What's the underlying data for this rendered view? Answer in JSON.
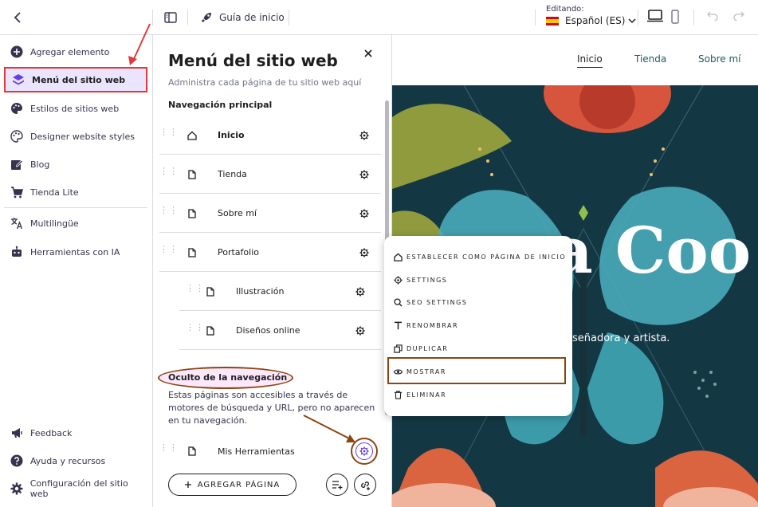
{
  "topbar": {
    "guide_label": "Guía de inicio",
    "editing_label": "Editando:",
    "language": "Español (ES)"
  },
  "sidebar": {
    "items": [
      {
        "label": "Agregar elemento",
        "icon": "plus-circle-icon"
      },
      {
        "label": "Menú del sitio web",
        "icon": "layers-icon",
        "active": true
      },
      {
        "label": "Estilos de sitios web",
        "icon": "palette-icon"
      },
      {
        "label": "Designer website styles",
        "icon": "palette-icon"
      },
      {
        "label": "Blog",
        "icon": "edit-icon"
      },
      {
        "label": "Tienda Lite",
        "icon": "cart-icon"
      },
      {
        "label": "Multilingüe",
        "icon": "translate-icon"
      },
      {
        "label": "Herramientas con IA",
        "icon": "robot-icon"
      }
    ],
    "bottom": [
      {
        "label": "Feedback",
        "icon": "megaphone-icon"
      },
      {
        "label": "Ayuda y recursos",
        "icon": "help-icon"
      },
      {
        "label": "Configuración del sitio web",
        "icon": "gear-icon"
      }
    ]
  },
  "panel": {
    "title": "Menú del sitio web",
    "subtitle": "Administra cada página de tu sitio web aquí",
    "main_nav_heading": "Navegación principal",
    "pages": [
      {
        "label": "Inicio",
        "icon": "home-icon",
        "bold": true,
        "indent": 0
      },
      {
        "label": "Tienda",
        "icon": "page-icon",
        "indent": 0
      },
      {
        "label": "Sobre mí",
        "icon": "page-icon",
        "indent": 0
      },
      {
        "label": "Portafolio",
        "icon": "page-icon",
        "indent": 0
      },
      {
        "label": "Illustración",
        "icon": "page-icon",
        "indent": 1
      },
      {
        "label": "Diseños online",
        "icon": "page-icon",
        "indent": 1
      }
    ],
    "hidden_heading": "Oculto de la navegación",
    "hidden_description": "Estas páginas son accesibles a través de motores de búsqueda y URL, pero no aparecen en tu navegación.",
    "hidden_pages": [
      {
        "label": "Mis Herramientas",
        "icon": "page-icon"
      }
    ],
    "add_page_label": "AGREGAR PÁGINA"
  },
  "preview": {
    "nav": [
      "Inicio",
      "Tienda",
      "Sobre mí"
    ],
    "hero_title": "a Coo",
    "hero_subtitle": "señadora y artista."
  },
  "context_menu": {
    "items": [
      {
        "label": "ESTABLECER COMO PÁGINA DE INICIO",
        "icon": "home-icon"
      },
      {
        "label": "SETTINGS",
        "icon": "gear-icon"
      },
      {
        "label": "SEO SETTINGS",
        "icon": "search-icon"
      },
      {
        "label": "RENOMBRAR",
        "icon": "text-icon"
      },
      {
        "label": "DUPLICAR",
        "icon": "duplicate-icon"
      },
      {
        "label": "MOSTRAR",
        "icon": "eye-icon",
        "highlighted": true
      },
      {
        "label": "ELIMINAR",
        "icon": "trash-icon"
      }
    ]
  },
  "colors": {
    "accent": "#673de6",
    "active_bg": "#ebe4ff",
    "annotation_red": "#e03a3a",
    "annotation_brown": "#8b4513",
    "hero_bg": "#143b49"
  }
}
